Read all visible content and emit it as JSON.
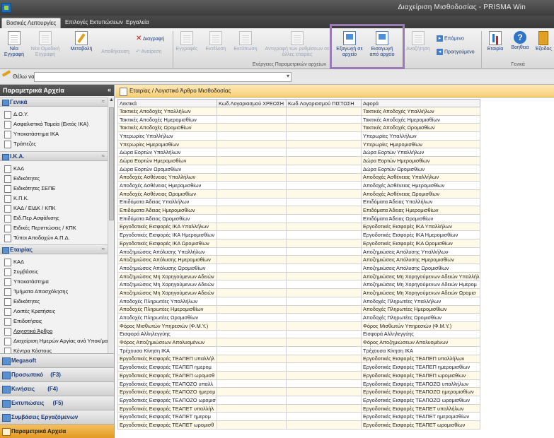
{
  "window": {
    "title": "Διαχείριση Μισθοδοσίας - PRISMA Win"
  },
  "ribbon_tabs": [
    "Βασικές Λειτουργίες",
    "Επιλογές Εκτυπώσεων",
    "Εργαλεία"
  ],
  "ribbon": {
    "new": "Νέα Εγγραφή",
    "new_group": "Νέα Ομαδική Εγγραφή",
    "edit": "Μεταβολή",
    "save": "Αποθήκευση",
    "delete": "Διαγραφή",
    "undo": "Αναίρεση",
    "records": "Εγγραφές",
    "execute": "Εκτέλεση",
    "print": "Εκτύπωση",
    "copy_settings": "Αντιγραφή των ρυθμίσεων σε άλλες εταιρίες",
    "export": "Εξαγωγή σε αρχείο",
    "import": "Εισαγωγή από αρχείο",
    "search": "Αναζήτηση",
    "next": "Επόμενο",
    "previous": "Προηγούμενο",
    "company": "Εταιρία",
    "help": "Βοήθεια",
    "exit": "Έξοδος",
    "group_params": "Ενέργειες Παραμετρικών αρχείων",
    "group_general": "Γενικά"
  },
  "search": {
    "label": "Θέλω να",
    "value": ""
  },
  "sidebar": {
    "title": "Παραμετρικά Αρχεία",
    "collapse": "«",
    "sections": [
      {
        "label": "Γενικά",
        "items": [
          "Δ.Ο.Υ.",
          "Ασφαλιστικά Ταμεία (Εκτός ΙΚΑ)",
          "Υποκατάστημα ΙΚΑ",
          "Τράπεζες"
        ]
      },
      {
        "label": "Ι.Κ.Α.",
        "items": [
          "ΚΑΔ",
          "Ειδικότητες",
          "Ειδικότητες ΣΕΠΕ",
          "Κ.Π.Κ.",
          "ΚΑΔ / ΕΙΔΚ / ΚΠΚ",
          "Ειδ.Περ.Ασφάλισης",
          "Ειδικές Περιπτώσεις / ΚΠΚ",
          "Τύποι Αποδοχών Α.Π.Δ."
        ]
      },
      {
        "label": "Εταιρίας",
        "items": [
          "ΚΑΔ",
          "Συμβάσεις",
          "Υποκατάστημα",
          "Τμήματα Απασχόλησης",
          "Ειδικότητες",
          "Λοιπές Κρατήσεις",
          "Επιδοτήσεις",
          "Λογιστικό Άρθρο",
          "Διαχείριση Ημερών Αργίας ανά Υποκ/μα",
          "Κέντρα Κόστους"
        ]
      }
    ],
    "nav": [
      {
        "label": "Megasoft",
        "hotkey": ""
      },
      {
        "label": "Προσωπικό",
        "hotkey": "(F3)"
      },
      {
        "label": "Κινήσεις",
        "hotkey": "(F4)"
      },
      {
        "label": "Εκτυπώσεις",
        "hotkey": "(F5)"
      },
      {
        "label": "Συμβάσεις Εργαζόμενων",
        "hotkey": ""
      },
      {
        "label": "Παραμετρικά Αρχεία",
        "hotkey": ""
      }
    ]
  },
  "main": {
    "breadcrumb": "Εταιρίας / Λογιστικό Άρθρο Μισθοδοσίας",
    "columns": [
      "Λεκτικά",
      "Κωδ.Λογαριασμού ΧΡΕΩΣΗ",
      "Κωδ.Λογαριασμού ΠΙΣΤΩΣΗ",
      "Αφορά"
    ],
    "rows": [
      [
        "Τακτικές Αποδοχές Υπαλλήλων",
        "",
        "",
        "Τακτικές Αποδοχές Υπαλλήλων"
      ],
      [
        "Τακτικές Αποδοχές Ημερομισθίων",
        "",
        "",
        "Τακτικές Αποδοχές Ημερομισθίων"
      ],
      [
        "Τακτικές Αποδοχές Ωρομισθίων",
        "",
        "",
        "Τακτικές Αποδοχές Ωρομισθίων"
      ],
      [
        "Υπερωρίες Υπαλλήλων",
        "",
        "",
        "Υπερωρίες Υπαλλήλων"
      ],
      [
        "Υπερωρίες Ημερομισθίων",
        "",
        "",
        "Υπερωρίες Ημερομισθίων"
      ],
      [
        "Δώρα Εορτών Υπαλλήλων",
        "",
        "",
        "Δώρα Εορτών Υπαλλήλων"
      ],
      [
        "Δώρα Εορτών Ημερομισθίων",
        "",
        "",
        "Δώρα Εορτών Ημερομισθίων"
      ],
      [
        "Δώρα Εορτών Ωρομισθίων",
        "",
        "",
        "Δώρα Εορτών Ωρομισθίων"
      ],
      [
        "Αποδοχές Ασθένειας Υπαλλήλων",
        "",
        "",
        "Αποδοχές Ασθένειας Υπαλλήλων"
      ],
      [
        "Αποδοχές Ασθένειας Ημερομισθίων",
        "",
        "",
        "Αποδοχές Ασθένειας Ημερομισθίων"
      ],
      [
        "Αποδοχές Ασθένειας Ωρομισθίων",
        "",
        "",
        "Αποδοχές Ασθένειας Ωρομισθίων"
      ],
      [
        "Επιδόματα Άδειας Υπαλλήλων",
        "",
        "",
        "Επιδόματα Άδειας Υπαλλήλων"
      ],
      [
        "Επιδόματα Άδειας Ημερομισθίων",
        "",
        "",
        "Επιδόματα Άδειας Ημερομισθίων"
      ],
      [
        "Επιδόματα Άδειας Ωρομισθίων",
        "",
        "",
        "Επιδόματα Άδειας Ωρομισθίων"
      ],
      [
        "Εργοδοτικές Εισφορές ΙΚΑ Υπαλλήλων",
        "",
        "",
        "Εργοδοτικές Εισφορές ΙΚΑ Υπαλλήλων"
      ],
      [
        "Εργοδοτικές Εισφορές ΙΚΑ Ημερομισθίων",
        "",
        "",
        "Εργοδοτικές Εισφορές ΙΚΑ Ημερομισθίων"
      ],
      [
        "Εργοδοτικές Εισφορές ΙΚΑ Ωρομισθίων",
        "",
        "",
        "Εργοδοτικές Εισφορές ΙΚΑ Ωρομισθίων"
      ],
      [
        "Αποζημιώσεις Απόλυσης Υπαλλήλων",
        "",
        "",
        "Αποζημιώσεις Απόλυσης Υπαλλήλων"
      ],
      [
        "Αποζημιώσεις Απόλυσης Ημερομισθίων",
        "",
        "",
        "Αποζημιώσεις Απόλυσης Ημερομισθίων"
      ],
      [
        "Αποζημιώσεις Απόλυσης Ωρομισθίων",
        "",
        "",
        "Αποζημιώσεις Απόλυσης Ωρομισθίων"
      ],
      [
        "Αποζημιώσεις Μη Χορηγούμενων Αδειών",
        "",
        "",
        "Αποζημιώσεις Μη Χορηγούμενων Αδειών Υπαλλήλ"
      ],
      [
        "Αποζημιώσεις Μη Χορηγούμενων Αδειών",
        "",
        "",
        "Αποζημιώσεις Μη Χορηγούμενων Αδειών Ημερομ"
      ],
      [
        "Αποζημιώσεις Μη Χορηγούμενων Αδειών",
        "",
        "",
        "Αποζημιώσεις Μη Χορηγούμενων Αδειών Ωρομισ"
      ],
      [
        "Αποδοχές Πληρωτέες Υπαλλήλων",
        "",
        "",
        "Αποδοχές Πληρωτέες Υπαλλήλων"
      ],
      [
        "Αποδοχές Πληρωτέες Ημερομισθίων",
        "",
        "",
        "Αποδοχές Πληρωτέες Ημερομισθίων"
      ],
      [
        "Αποδοχές Πληρωτέες Ωρομισθίων",
        "",
        "",
        "Αποδοχές Πληρωτέες Ωρομισθίων"
      ],
      [
        "Φόρος Μισθωτών Υπηρεσιών (Φ.Μ.Υ.)",
        "",
        "",
        "Φόρος Μισθωτών Υπηρεσιών (Φ.Μ.Υ.)"
      ],
      [
        "Εισφορά Αλληλεγγύης",
        "",
        "",
        "Εισφορά Αλληλεγγύης"
      ],
      [
        "Φόρος Αποζημιώσεων Απολυομένων",
        "",
        "",
        "Φόρος Αποζημιώσεων Απολυομένων"
      ],
      [
        "Τρέχουσα Κίνηση ΙΚΑ",
        "",
        "",
        "Τρέχουσα Κίνηση ΙΚΑ"
      ],
      [
        "Εργοδοτικές Εισφορές ΤΕΑΠΕΠ υπαλλήλ",
        "",
        "",
        "Εργοδοτικές Εισφορές ΤΕΑΠΕΠ υπαλλήλων"
      ],
      [
        "Εργοδοτικές Εισφορές ΤΕΑΠΕΠ ημερομ",
        "",
        "",
        "Εργοδοτικές Εισφορές ΤΕΑΠΕΠ ημερομισθίων"
      ],
      [
        "Εργοδοτικές Εισφορές ΤΕΑΠΕΠ ωρομισθ",
        "",
        "",
        "Εργοδοτικές Εισφορές ΤΕΑΠΕΠ ωρομισθίων"
      ],
      [
        "Εργοδοτικές Εισφορές ΤΕΑΠΟΖΟ υπαλλ",
        "",
        "",
        "Εργοδοτικές Εισφορές ΤΕΑΠΟΖΟ υπαλλήλων"
      ],
      [
        "Εργοδοτικές Εισφορές ΤΕΑΠΟΖΟ ημερομ",
        "",
        "",
        "Εργοδοτικές Εισφορές ΤΕΑΠΟΖΟ ημερομισθίων"
      ],
      [
        "Εργοδοτικές Εισφορές ΤΕΑΠΟΖΟ ωρομισ",
        "",
        "",
        "Εργοδοτικές Εισφορές ΤΕΑΠΟΖΟ ωρομισθίων"
      ],
      [
        "Εργοδοτικές Εισφορές ΤΕΑΠΕΤ υπαλλήλ",
        "",
        "",
        "Εργοδοτικές Εισφορές ΤΕΑΠΕΤ υπαλλήλων"
      ],
      [
        "Εργοδοτικές Εισφορές ΤΕΑΠΕΤ ημερομ",
        "",
        "",
        "Εργοδοτικές Εισφορές ΤΕΑΠΕΤ ημερομισθίων"
      ],
      [
        "Εργοδοτικές Εισφορές ΤΕΑΠΕΤ ωρομισθ",
        "",
        "",
        "Εργοδοτικές Εισφορές ΤΕΑΠΕΤ ωρομισθίων"
      ]
    ]
  }
}
